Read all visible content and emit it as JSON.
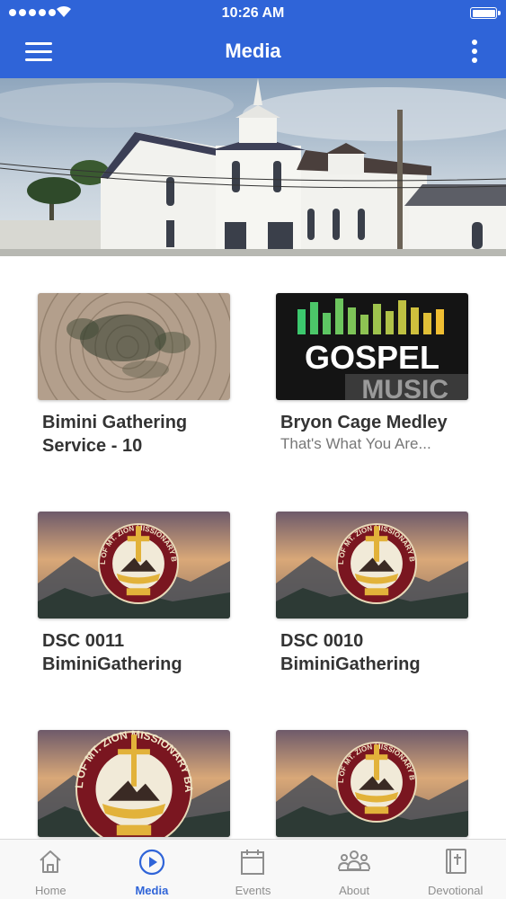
{
  "status_bar": {
    "time": "10:26 AM"
  },
  "header": {
    "title": "Media",
    "menu_icon": "hamburger-menu-icon",
    "more_icon": "more-vertical-icon"
  },
  "media_items": [
    {
      "title": "Bimini Gathering Service - 10",
      "subtitle": "",
      "thumbnail": "wood-rings-image"
    },
    {
      "title": "Bryon Cage Medley",
      "subtitle": "That's What You Are...",
      "thumbnail": "gospel-music-image"
    },
    {
      "title": "DSC 0011 BiminiGathering",
      "subtitle": "",
      "thumbnail": "church-seal-image"
    },
    {
      "title": "DSC 0010 BiminiGathering",
      "subtitle": "",
      "thumbnail": "church-seal-image"
    },
    {
      "title": "",
      "subtitle": "",
      "thumbnail": "church-seal-image"
    },
    {
      "title": "",
      "subtitle": "",
      "thumbnail": "church-seal-image"
    }
  ],
  "thumbnail_text": {
    "gospel_line1": "GOSPEL",
    "gospel_line2": "MUSIC",
    "seal_text": "THE CATHEDRAL OF MT. ZION MISSIONARY BAPTIST CHURCH"
  },
  "tabs": [
    {
      "label": "Home",
      "icon": "home-icon",
      "active": false
    },
    {
      "label": "Media",
      "icon": "play-circle-icon",
      "active": true
    },
    {
      "label": "Events",
      "icon": "calendar-icon",
      "active": false
    },
    {
      "label": "About",
      "icon": "people-icon",
      "active": false
    },
    {
      "label": "Devotional",
      "icon": "bible-icon",
      "active": false
    }
  ],
  "colors": {
    "accent": "#2f64d8",
    "tab_inactive": "#8e8e8e",
    "tab_bar_bg": "#f8f8f8",
    "title_text": "#333333",
    "subtitle_text": "#777777"
  }
}
